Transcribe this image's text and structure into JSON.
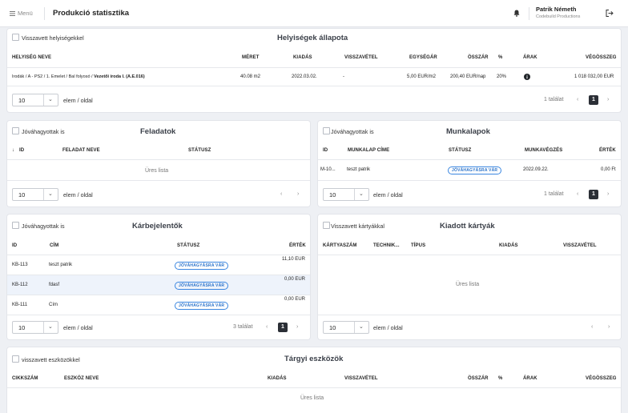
{
  "header": {
    "menu_label": "Menü",
    "page_title": "Produkció statisztika",
    "user_name": "Patrik Németh",
    "user_company": "Codebuild Productions"
  },
  "rooms": {
    "checkbox_label": "Visszavett helyiségekkel",
    "title": "Helyiségek állapota",
    "columns": [
      "HELYISÉG NEVE",
      "MÉRET",
      "KIADÁS",
      "VISSZAVÉTEL",
      "EGYSÉGÁR",
      "ÖSSZÁR",
      "%",
      "ÁRAK",
      "VÉGÖSSZEG"
    ],
    "row": {
      "path": "Irodák / A - PS2 / 1. Emelet / Bal folyosó / ",
      "name": "Vezetői iroda I. (A.E.016)",
      "size": "40.08 m2",
      "rent": "2022.03.02.",
      "return": "-",
      "unit_price": "5,00 EUR/m2",
      "total": "200,40 EUR/nap",
      "percent": "20%",
      "grand_total": "1 018 032,00 EUR"
    },
    "per_page": "10",
    "per_page_label": "elem / oldal",
    "results": "1 találat",
    "page": "1"
  },
  "tasks": {
    "checkbox_label": "Jóváhagyottak is",
    "title": "Feladatok",
    "columns": [
      "ID",
      "FELADAT NEVE",
      "STÁTUSZ"
    ],
    "empty": "Üres lista",
    "per_page": "10",
    "per_page_label": "elem / oldal"
  },
  "worksheets": {
    "checkbox_label": "Jóváhagyottak is",
    "title": "Munkalapok",
    "columns": [
      "ID",
      "MUNKALAP CÍME",
      "STÁTUSZ",
      "MUNKAVÉGZÉS",
      "ÉRTÉK"
    ],
    "row": {
      "id": "M-10...",
      "title": "teszt patrik",
      "status": "JÓVÁHAGYÁSRA VÁR",
      "date": "2022.09.22.",
      "value": "0,00 Ft"
    },
    "per_page": "10",
    "per_page_label": "elem / oldal",
    "results": "1 találat",
    "page": "1"
  },
  "damage": {
    "checkbox_label": "Jóváhagyottak is",
    "title": "Kárbejelentők",
    "columns": [
      "ID",
      "CÍM",
      "STÁTUSZ",
      "ÉRTÉK"
    ],
    "rows": [
      {
        "id": "KB-113",
        "title": "teszt patrik",
        "status": "JÓVÁHAGYÁSRA VÁR",
        "value": "11,10 EUR"
      },
      {
        "id": "KB-112",
        "title": "fdasf",
        "status": "JÓVÁHAGYÁSRA VÁR",
        "value": "0,00 EUR"
      },
      {
        "id": "KB-111",
        "title": "Cím",
        "status": "JÓVÁHAGYÁSRA VÁR",
        "value": "0,00 EUR"
      }
    ],
    "per_page": "10",
    "per_page_label": "elem / oldal",
    "results": "3 találat",
    "page": "1"
  },
  "cards": {
    "checkbox_label": "Visszavett kártyákkal",
    "title": "Kiadott kártyák",
    "columns": [
      "KÁRTYASZÁM",
      "TECHNIK...",
      "TÍPUS",
      "KIADÁS",
      "VISSZAVÉTEL"
    ],
    "empty": "Üres lista",
    "per_page": "10",
    "per_page_label": "elem / oldal"
  },
  "assets": {
    "checkbox_label": "visszavett eszközökkel",
    "title": "Tárgyi eszközök",
    "columns": [
      "CIKKSZÁM",
      "ESZKÖZ NEVE",
      "KIADÁS",
      "VISSZAVÉTEL",
      "ÖSSZÁR",
      "%",
      "ÁRAK",
      "VÉGÖSSZEG"
    ],
    "empty": "Üres lista"
  },
  "icons": {
    "menu": "hamburger-icon",
    "bell": "bell-icon",
    "logout": "logout-icon",
    "info": "info-icon",
    "sort": "sort-down-icon"
  }
}
